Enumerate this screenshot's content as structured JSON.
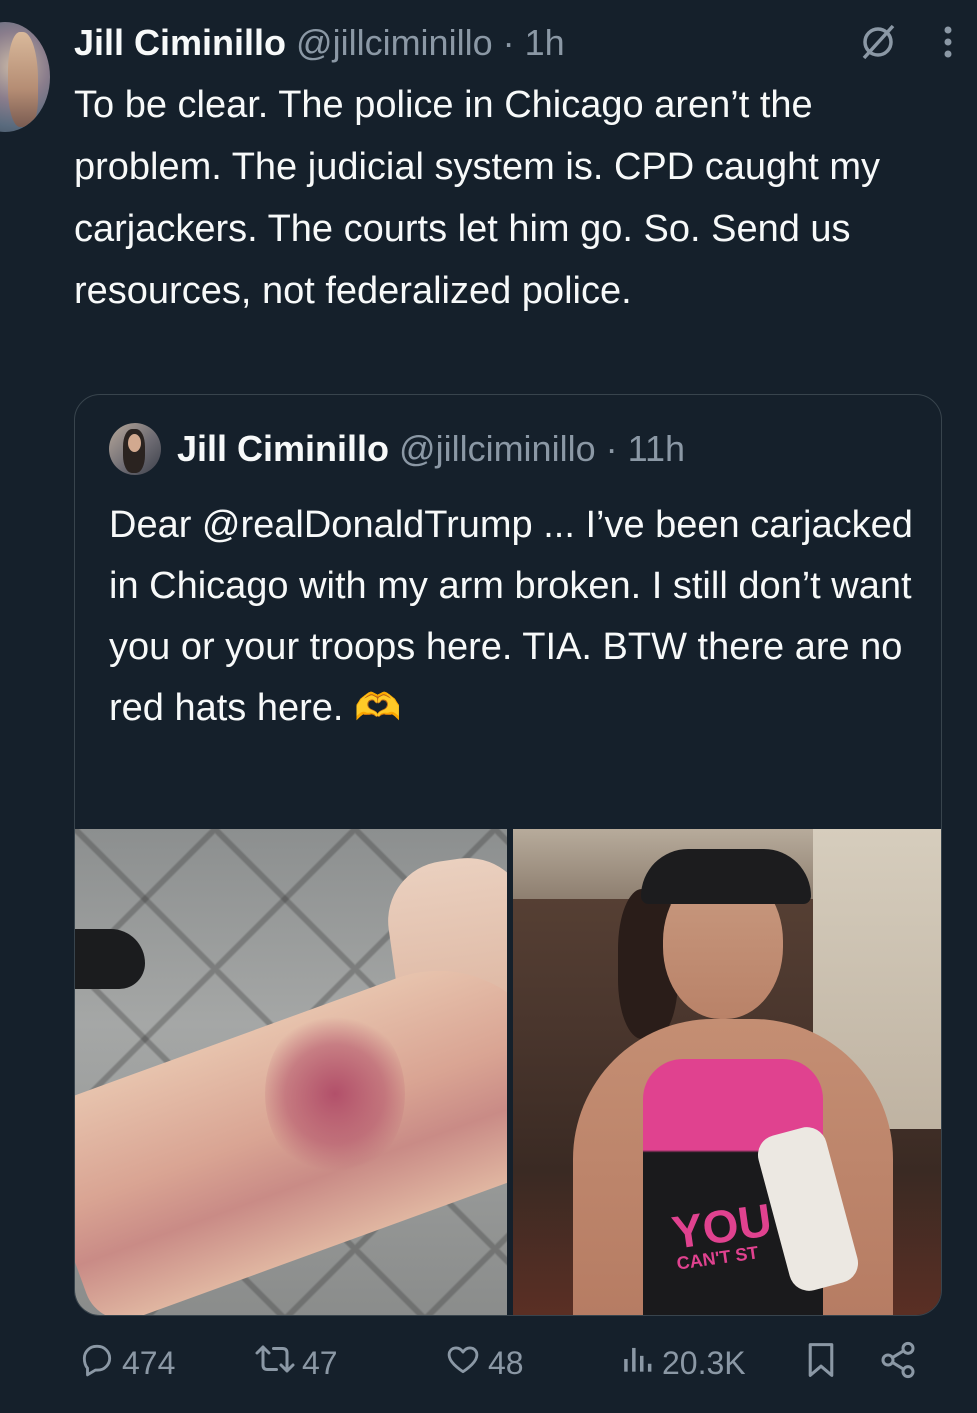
{
  "tweet": {
    "author_name": "Jill Ciminillo",
    "handle": "@jillciminillo",
    "time": "1h",
    "text": "To be clear. The police in Chicago aren’t the problem. The judicial system is. CPD caught my carjackers. The courts let him go. So. Send us resources, not federalized police."
  },
  "quoted": {
    "author_name": "Jill Ciminillo",
    "handle": "@jillciminillo",
    "time": "11h",
    "text": "Dear @realDonaldTrump ... I’ve been carjacked in Chicago with my arm broken. I still don’t want you or your troops here. TIA. BTW there are no red hats here. 🫶",
    "image_right_text": "YOU",
    "image_right_subtext": "CAN'T ST"
  },
  "actions": {
    "replies": "474",
    "reposts": "47",
    "likes": "48",
    "views": "20.3K"
  },
  "icons": {
    "grok": "grok-icon",
    "more": "more-icon",
    "reply": "reply-icon",
    "repost": "repost-icon",
    "like": "like-icon",
    "views": "views-icon",
    "bookmark": "bookmark-icon",
    "share": "share-icon"
  },
  "colors": {
    "background": "#15202b",
    "text": "#f7f9f9",
    "muted": "#8b98a5",
    "border": "#38444d"
  }
}
